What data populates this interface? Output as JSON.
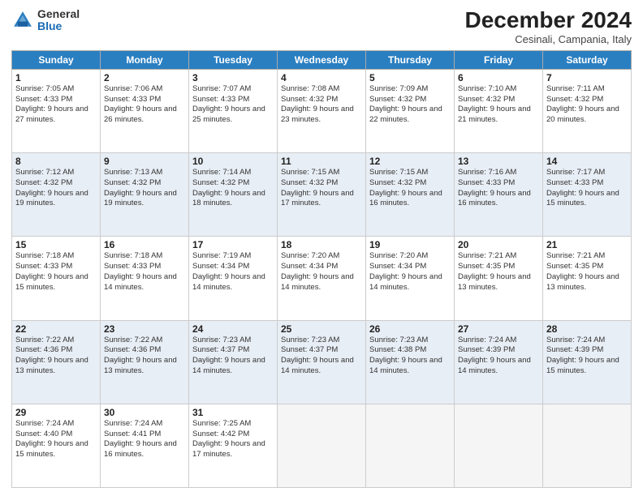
{
  "logo": {
    "general": "General",
    "blue": "Blue"
  },
  "title": "December 2024",
  "location": "Cesinali, Campania, Italy",
  "headers": [
    "Sunday",
    "Monday",
    "Tuesday",
    "Wednesday",
    "Thursday",
    "Friday",
    "Saturday"
  ],
  "weeks": [
    [
      {
        "day": "1",
        "info": "Sunrise: 7:05 AM\nSunset: 4:33 PM\nDaylight: 9 hours and 27 minutes."
      },
      {
        "day": "2",
        "info": "Sunrise: 7:06 AM\nSunset: 4:33 PM\nDaylight: 9 hours and 26 minutes."
      },
      {
        "day": "3",
        "info": "Sunrise: 7:07 AM\nSunset: 4:33 PM\nDaylight: 9 hours and 25 minutes."
      },
      {
        "day": "4",
        "info": "Sunrise: 7:08 AM\nSunset: 4:32 PM\nDaylight: 9 hours and 23 minutes."
      },
      {
        "day": "5",
        "info": "Sunrise: 7:09 AM\nSunset: 4:32 PM\nDaylight: 9 hours and 22 minutes."
      },
      {
        "day": "6",
        "info": "Sunrise: 7:10 AM\nSunset: 4:32 PM\nDaylight: 9 hours and 21 minutes."
      },
      {
        "day": "7",
        "info": "Sunrise: 7:11 AM\nSunset: 4:32 PM\nDaylight: 9 hours and 20 minutes."
      }
    ],
    [
      {
        "day": "8",
        "info": "Sunrise: 7:12 AM\nSunset: 4:32 PM\nDaylight: 9 hours and 19 minutes."
      },
      {
        "day": "9",
        "info": "Sunrise: 7:13 AM\nSunset: 4:32 PM\nDaylight: 9 hours and 19 minutes."
      },
      {
        "day": "10",
        "info": "Sunrise: 7:14 AM\nSunset: 4:32 PM\nDaylight: 9 hours and 18 minutes."
      },
      {
        "day": "11",
        "info": "Sunrise: 7:15 AM\nSunset: 4:32 PM\nDaylight: 9 hours and 17 minutes."
      },
      {
        "day": "12",
        "info": "Sunrise: 7:15 AM\nSunset: 4:32 PM\nDaylight: 9 hours and 16 minutes."
      },
      {
        "day": "13",
        "info": "Sunrise: 7:16 AM\nSunset: 4:33 PM\nDaylight: 9 hours and 16 minutes."
      },
      {
        "day": "14",
        "info": "Sunrise: 7:17 AM\nSunset: 4:33 PM\nDaylight: 9 hours and 15 minutes."
      }
    ],
    [
      {
        "day": "15",
        "info": "Sunrise: 7:18 AM\nSunset: 4:33 PM\nDaylight: 9 hours and 15 minutes."
      },
      {
        "day": "16",
        "info": "Sunrise: 7:18 AM\nSunset: 4:33 PM\nDaylight: 9 hours and 14 minutes."
      },
      {
        "day": "17",
        "info": "Sunrise: 7:19 AM\nSunset: 4:34 PM\nDaylight: 9 hours and 14 minutes."
      },
      {
        "day": "18",
        "info": "Sunrise: 7:20 AM\nSunset: 4:34 PM\nDaylight: 9 hours and 14 minutes."
      },
      {
        "day": "19",
        "info": "Sunrise: 7:20 AM\nSunset: 4:34 PM\nDaylight: 9 hours and 14 minutes."
      },
      {
        "day": "20",
        "info": "Sunrise: 7:21 AM\nSunset: 4:35 PM\nDaylight: 9 hours and 13 minutes."
      },
      {
        "day": "21",
        "info": "Sunrise: 7:21 AM\nSunset: 4:35 PM\nDaylight: 9 hours and 13 minutes."
      }
    ],
    [
      {
        "day": "22",
        "info": "Sunrise: 7:22 AM\nSunset: 4:36 PM\nDaylight: 9 hours and 13 minutes."
      },
      {
        "day": "23",
        "info": "Sunrise: 7:22 AM\nSunset: 4:36 PM\nDaylight: 9 hours and 13 minutes."
      },
      {
        "day": "24",
        "info": "Sunrise: 7:23 AM\nSunset: 4:37 PM\nDaylight: 9 hours and 14 minutes."
      },
      {
        "day": "25",
        "info": "Sunrise: 7:23 AM\nSunset: 4:37 PM\nDaylight: 9 hours and 14 minutes."
      },
      {
        "day": "26",
        "info": "Sunrise: 7:23 AM\nSunset: 4:38 PM\nDaylight: 9 hours and 14 minutes."
      },
      {
        "day": "27",
        "info": "Sunrise: 7:24 AM\nSunset: 4:39 PM\nDaylight: 9 hours and 14 minutes."
      },
      {
        "day": "28",
        "info": "Sunrise: 7:24 AM\nSunset: 4:39 PM\nDaylight: 9 hours and 15 minutes."
      }
    ],
    [
      {
        "day": "29",
        "info": "Sunrise: 7:24 AM\nSunset: 4:40 PM\nDaylight: 9 hours and 15 minutes."
      },
      {
        "day": "30",
        "info": "Sunrise: 7:24 AM\nSunset: 4:41 PM\nDaylight: 9 hours and 16 minutes."
      },
      {
        "day": "31",
        "info": "Sunrise: 7:25 AM\nSunset: 4:42 PM\nDaylight: 9 hours and 17 minutes."
      },
      null,
      null,
      null,
      null
    ]
  ]
}
